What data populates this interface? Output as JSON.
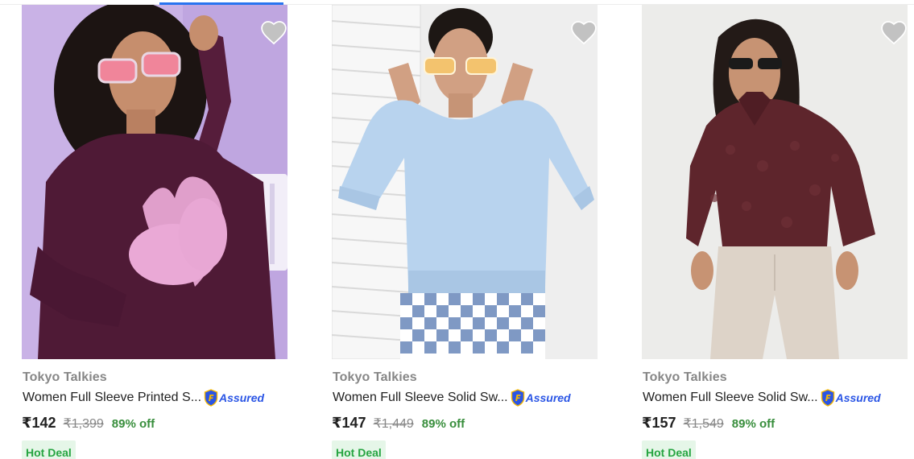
{
  "products": [
    {
      "brand": "Tokyo Talkies",
      "title": "Women Full Sleeve Printed S...",
      "assured": "Assured",
      "price": "₹142",
      "mrp": "₹1,399",
      "discount": "89% off",
      "deal": "Hot Deal",
      "image_description": "Model in maroon sweatshirt with pink text print",
      "colors": {
        "background": "#c9b2e6",
        "garment": "#4f1a36"
      },
      "wishlist_icon": "heart-icon"
    },
    {
      "brand": "Tokyo Talkies",
      "title": "Women Full Sleeve Solid Sw...",
      "assured": "Assured",
      "price": "₹147",
      "mrp": "₹1,449",
      "discount": "89% off",
      "deal": "Hot Deal",
      "image_description": "Model in light blue solid sweatshirt",
      "colors": {
        "background": "#eeeeee",
        "garment": "#b8d3ee"
      },
      "wishlist_icon": "heart-icon"
    },
    {
      "brand": "Tokyo Talkies",
      "title": "Women Full Sleeve Solid Sw...",
      "assured": "Assured",
      "price": "₹157",
      "mrp": "₹1,549",
      "discount": "89% off",
      "deal": "Hot Deal",
      "image_description": "Model in maroon fleece half-zip sweatshirt",
      "colors": {
        "background": "#ececea",
        "garment": "#5e252c"
      },
      "wishlist_icon": "heart-icon"
    }
  ],
  "colors": {
    "accent": "#2874f0",
    "discount_green": "#388e3c",
    "deal_green": "#26a541",
    "assured_blue": "#2a55e5"
  }
}
